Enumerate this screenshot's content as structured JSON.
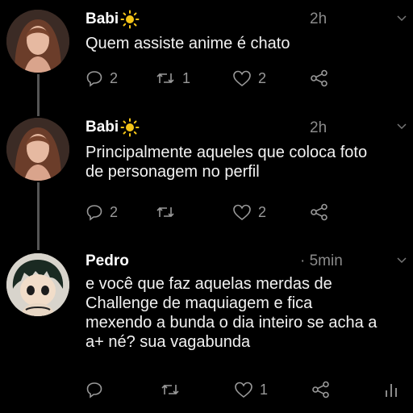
{
  "tweets": [
    {
      "author": "Babi",
      "time": "2h",
      "text": "Quem assiste anime é chato",
      "replies": "2",
      "retweets": "1",
      "likes": "2"
    },
    {
      "author": "Babi",
      "time": "2h",
      "text": "Principalmente aqueles que coloca foto\nde personagem no perfil",
      "replies": "2",
      "retweets": "",
      "likes": "2"
    },
    {
      "author": "Pedro",
      "time": "· 5min",
      "text": "e você que faz aquelas merdas de\nChallenge de maquiagem e fica\nmexendo a bunda o dia inteiro se acha a\na+ né? sua vagabunda",
      "replies": "",
      "retweets": "",
      "likes": "1"
    }
  ],
  "icons": [
    "sun-icon",
    "reply-icon",
    "retweet-icon",
    "like-icon",
    "share-icon",
    "analytics-icon",
    "chevron-down-icon"
  ],
  "colors": {
    "background": "#000000",
    "text": "#ffffff",
    "muted": "#8b8b8b",
    "thread": "#555555"
  }
}
